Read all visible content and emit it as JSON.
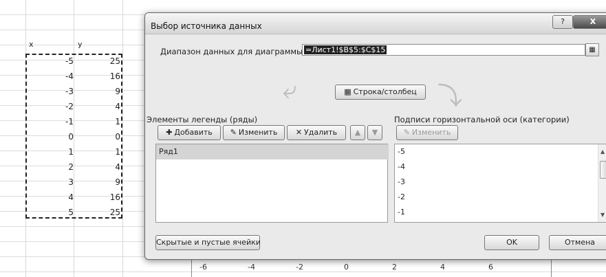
{
  "sheet": {
    "col_x": "x",
    "col_y": "y",
    "x_values": [
      "-5",
      "-4",
      "-3",
      "-2",
      "-1",
      "0",
      "1",
      "2",
      "3",
      "4",
      "5"
    ],
    "y_values": [
      "25",
      "16",
      "9",
      "4",
      "1",
      "0",
      "1",
      "4",
      "9",
      "16",
      "25"
    ],
    "chart_axis_ticks": [
      "-6",
      "-4",
      "-2",
      "0",
      "2",
      "4",
      "6"
    ]
  },
  "dialog": {
    "title": "Выбор источника данных",
    "help_label": "?",
    "close_label": "X",
    "range_label": "Диапазон данных для диаграммы:",
    "range_value": "=Лист1!$B$5:$C$15",
    "switch_label": "Строка/столбец",
    "legend_section_label": "Элементы легенды (ряды)",
    "axis_section_label": "Подписи горизонтальной оси (категории)",
    "add_label": "Добавить",
    "edit_label": "Изменить",
    "delete_label": "Удалить",
    "axis_edit_label": "Изменить",
    "series": [
      "Ряд1"
    ],
    "categories": [
      "-5",
      "-4",
      "-3",
      "-2",
      "-1"
    ],
    "hidden_cells_label": "Скрытые и пустые ячейки",
    "ok_label": "OK",
    "cancel_label": "Отмена"
  },
  "icons": {
    "collapse": "collapse-dialog-icon",
    "switch": "switch-row-column-icon",
    "add": "add-icon",
    "edit": "edit-icon",
    "delete": "delete-icon",
    "move_up": "move-up-icon",
    "move_down": "move-down-icon"
  }
}
